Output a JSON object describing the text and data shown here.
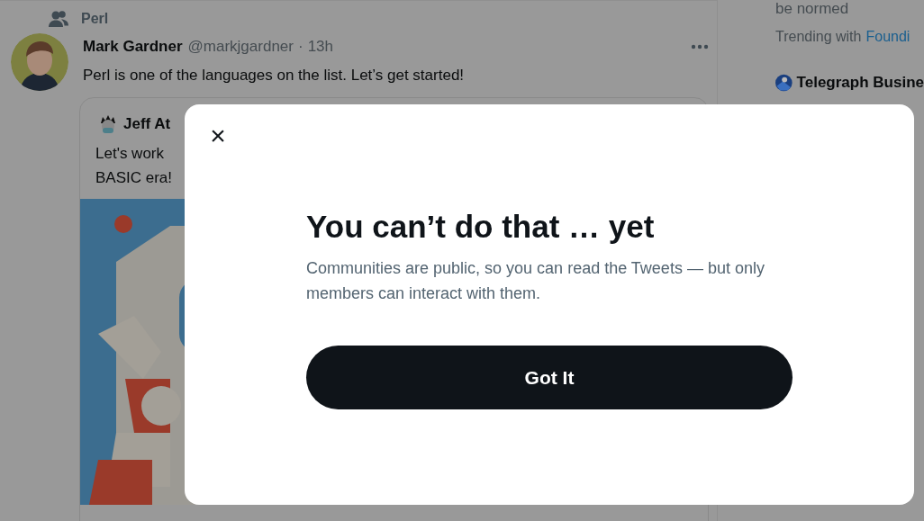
{
  "tweet": {
    "context": "Perl",
    "author": "Mark Gardner",
    "handle": "@markjgardner",
    "separator": "·",
    "time": "13h",
    "text": "Perl is one of the languages on the list. Let’s get started!",
    "quote": {
      "author": "Jeff At",
      "lines": [
        "Let's work",
        "BASIC era!"
      ]
    }
  },
  "sidebar": {
    "trend_tail": "be normed",
    "trending_label": "Trending with",
    "trending_link": "Foundi",
    "news_source": "Telegraph Busine"
  },
  "dialog": {
    "close": "×",
    "title": "You can’t do that … yet",
    "body": "Communities are public, so you can read the Tweets — but only members can interact with them.",
    "button": "Got It"
  }
}
